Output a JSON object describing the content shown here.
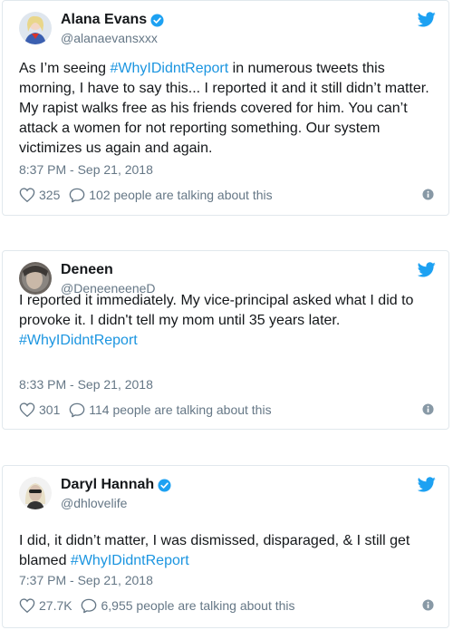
{
  "colors": {
    "link": "#1b95e0",
    "secondary": "#657786",
    "text": "#14171a",
    "border": "#e1e8ed",
    "twitter_blue": "#1da1f2"
  },
  "tweets": [
    {
      "name": "Alana Evans",
      "verified": true,
      "handle": "@alanaevansxxx",
      "text_before": "As I’m seeing ",
      "hashtag": "#WhyIDidntReport",
      "text_after": " in numerous tweets this morning, I have to say this... I reported it and it still didn’t matter. My rapist walks free as his friends covered for him. You can’t attack a women for not reporting something. Our system victimizes us again and again.",
      "timestamp": "8:37 PM - Sep 21, 2018",
      "likes": "325",
      "talking": "102 people are talking about this",
      "icons": [
        "twitter-bird-icon",
        "verified-icon",
        "heart-icon",
        "speech-bubble-icon",
        "info-icon"
      ]
    },
    {
      "name": "Deneen",
      "verified": false,
      "handle": "@DeneeneeneD",
      "text_before": "I reported it immediately. My vice-principal asked what I did to provoke it. I didn't tell my mom until 35 years later. ",
      "hashtag": "#WhyIDidntReport",
      "text_after": "",
      "timestamp": "8:33 PM - Sep 21, 2018",
      "likes": "301",
      "talking": "114 people are talking about this"
    },
    {
      "name": "Daryl Hannah",
      "verified": true,
      "handle": "@dhlovelife",
      "text_before": "I did, it didn’t matter, I was dismissed, disparaged, & I still get blamed  ",
      "hashtag": "#WhyIDidntReport",
      "text_after": "",
      "timestamp": "7:37 PM - Sep 21, 2018",
      "likes": "27.7K",
      "talking": "6,955 people are talking about this"
    }
  ]
}
